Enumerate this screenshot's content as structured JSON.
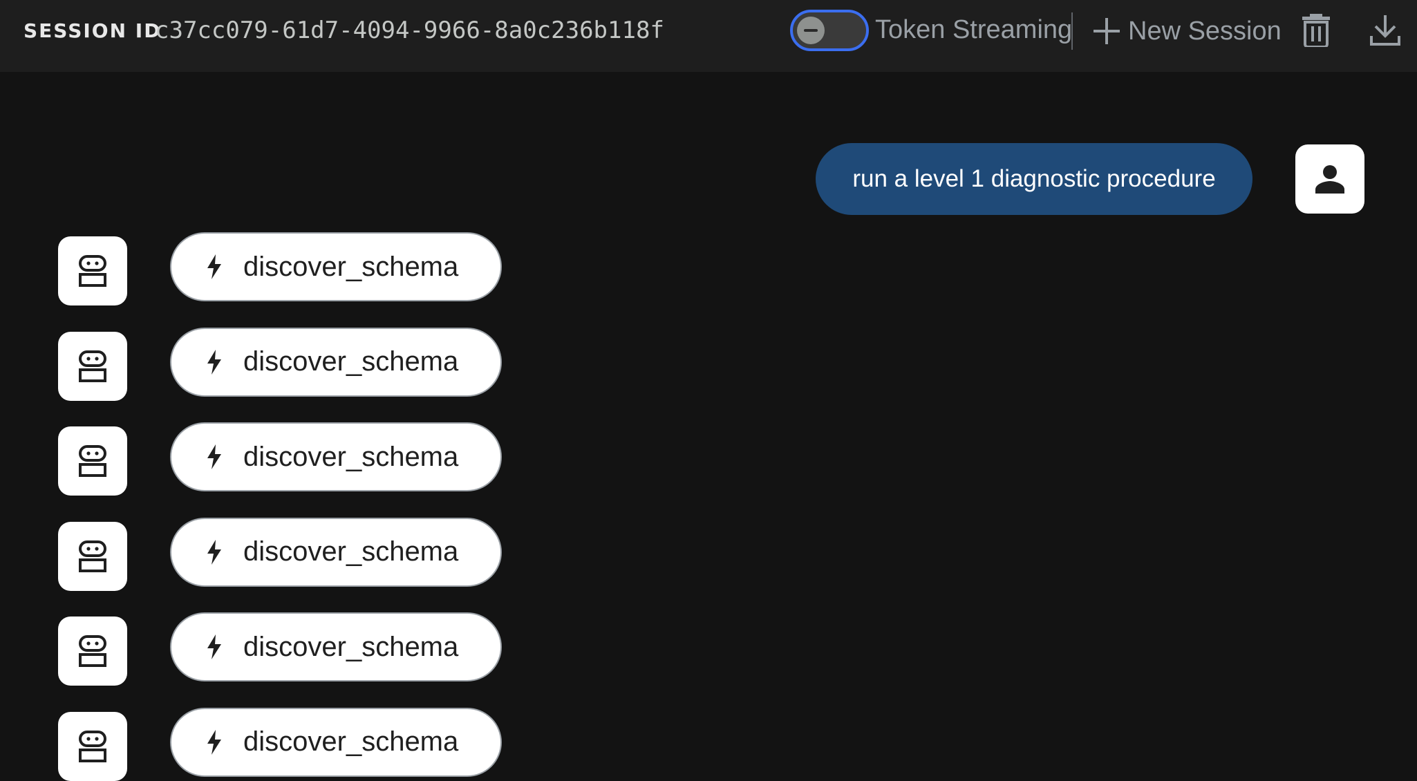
{
  "header": {
    "session_label": "SESSION ID",
    "session_id": "c37cc079-61d7-4094-9966-8a0c236b118f",
    "toggle_label": "Token Streaming",
    "toggle_state": "off",
    "new_session_label": "New Session",
    "icons": [
      "plus-icon",
      "trash-icon",
      "download-icon"
    ]
  },
  "chat": {
    "user_message": "run a level 1 diagnostic procedure",
    "tool_calls": [
      {
        "name": "discover_schema"
      },
      {
        "name": "discover_schema"
      },
      {
        "name": "discover_schema"
      },
      {
        "name": "discover_schema"
      },
      {
        "name": "discover_schema"
      },
      {
        "name": "discover_schema"
      }
    ]
  },
  "colors": {
    "background": "#131313",
    "header": "#1e1e1e",
    "user_bubble": "#1f4a78",
    "toggle_accent": "#3b6ef0"
  }
}
